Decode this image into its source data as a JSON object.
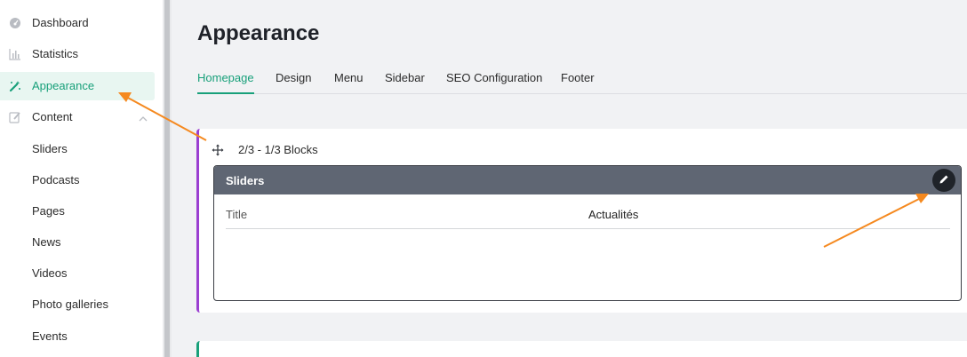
{
  "sidebar": {
    "items": [
      {
        "label": "Dashboard",
        "icon": "dashboard-icon"
      },
      {
        "label": "Statistics",
        "icon": "statistics-icon"
      },
      {
        "label": "Appearance",
        "icon": "appearance-wand-icon",
        "active": true
      },
      {
        "label": "Content",
        "icon": "content-edit-icon",
        "expanded": true
      }
    ],
    "content_subitems": [
      "Sliders",
      "Podcasts",
      "Pages",
      "News",
      "Videos",
      "Photo galleries",
      "Events"
    ]
  },
  "page": {
    "title": "Appearance"
  },
  "tabs": [
    {
      "label": "Homepage",
      "active": true
    },
    {
      "label": "Design"
    },
    {
      "label": "Menu"
    },
    {
      "label": "Sidebar"
    },
    {
      "label": "SEO Configuration"
    },
    {
      "label": "Footer"
    }
  ],
  "block": {
    "layout_label": "2/3 - 1/3 Blocks",
    "widget": {
      "title": "Sliders",
      "rows": [
        {
          "key": "Title",
          "value": "Actualités"
        }
      ]
    }
  },
  "colors": {
    "accent": "#18a07a",
    "block_border": "#9b3fd1",
    "widget_header": "#5f6673",
    "annotation": "#f5891f"
  }
}
